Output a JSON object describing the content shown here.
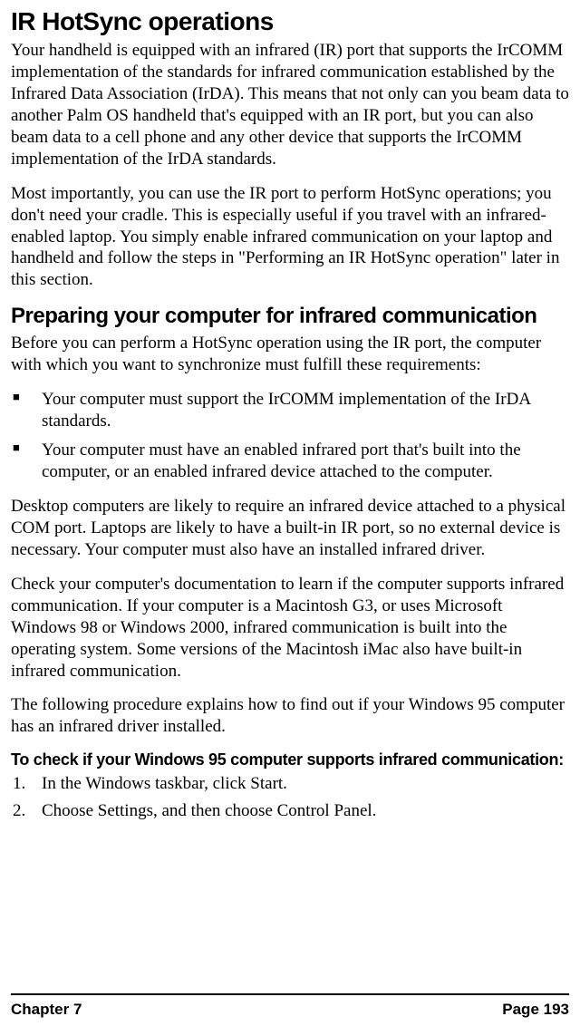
{
  "heading1": "IR HotSync operations",
  "para1": "Your handheld is equipped with an infrared (IR) port that supports the IrCOMM implementation of the standards for infrared communication established by the Infrared Data Association (IrDA). This means that not only can you beam data to another Palm OS handheld that's equipped with an IR port, but you can also beam data to a cell phone and any other device that supports the IrCOMM implementation of the IrDA standards.",
  "para2": "Most importantly, you can use the IR port to perform HotSync operations; you don't need your cradle. This is especially useful if you travel with an infrared-enabled laptop. You simply enable infrared communication on your laptop and handheld and follow the steps in \"Performing an IR HotSync operation\" later in this section.",
  "heading2": "Preparing your computer for infrared communication",
  "para3": "Before you can perform a HotSync operation using the IR port, the computer with which you want to synchronize must fulfill these requirements:",
  "bullets": [
    "Your computer must support the IrCOMM implementation of the IrDA standards.",
    "Your computer must have an enabled infrared port that's built into the computer, or an enabled infrared device attached to the computer."
  ],
  "para4": "Desktop computers are likely to require an infrared device attached to a physical COM port. Laptops are likely to have a built-in IR port, so no external device is necessary. Your computer must also have an installed infrared driver.",
  "para5": "Check your computer's documentation to learn if the computer supports infrared communication. If your computer is a Macintosh G3, or uses Microsoft Windows 98 or Windows 2000, infrared communication is built into the operating system. Some versions of the Macintosh iMac also have built-in infrared communication.",
  "para6": "The following procedure explains how to find out if your Windows 95 computer has an infrared driver installed.",
  "heading3": "To check if your Windows 95 computer supports infrared communication:",
  "steps": [
    "In the Windows taskbar, click Start.",
    "Choose Settings, and then choose Control Panel."
  ],
  "footer": {
    "left": "Chapter 7",
    "right": "Page 193"
  }
}
